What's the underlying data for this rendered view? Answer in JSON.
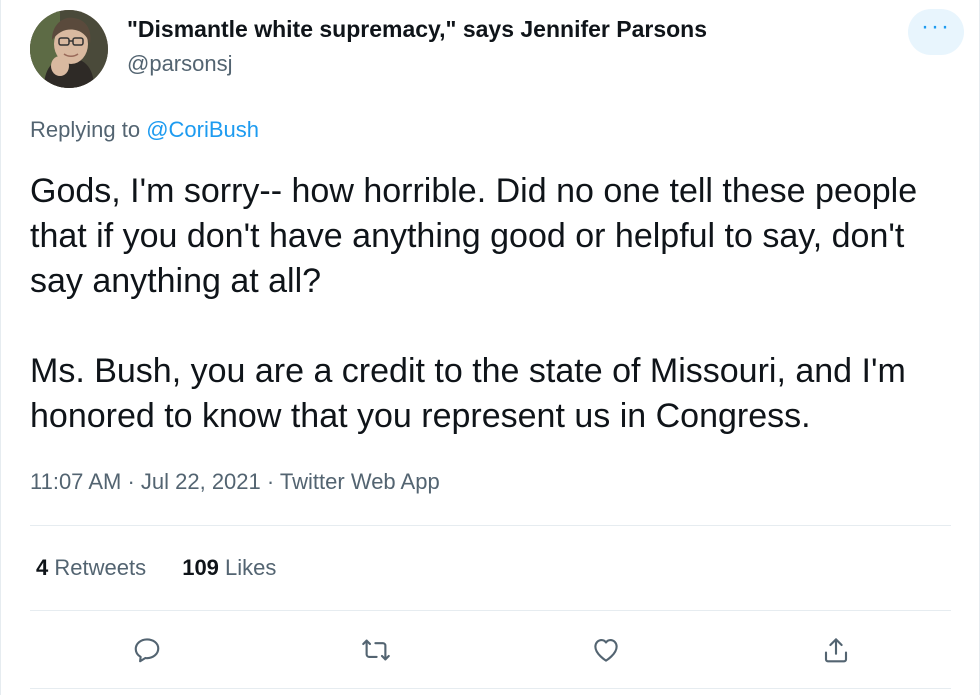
{
  "author": {
    "display_name": "\"Dismantle white supremacy,\" says Jennifer Parsons",
    "handle": "@parsonsj",
    "avatar_icon": "profile-photo"
  },
  "more_button": {
    "icon": "more-horizontal-icon",
    "label": "···"
  },
  "replying": {
    "prefix": "Replying to ",
    "mention": "@CoriBush"
  },
  "body": {
    "paragraph_1": "Gods, I'm sorry-- how horrible. Did no one tell these people that if you don't have anything good or helpful to say, don't say anything at all?",
    "paragraph_2": "Ms. Bush, you are a credit to the state of Missouri, and I'm honored to know that you represent us in Congress."
  },
  "meta": {
    "time": "11:07 AM",
    "separator_1": " · ",
    "date": "Jul 22, 2021",
    "separator_2": " · ",
    "source": "Twitter Web App"
  },
  "stats": {
    "retweets_count": "4",
    "retweets_label": " Retweets",
    "likes_count": "109",
    "likes_label": " Likes"
  },
  "actions": [
    {
      "name": "reply",
      "icon": "reply-icon"
    },
    {
      "name": "retweet",
      "icon": "retweet-icon"
    },
    {
      "name": "like",
      "icon": "heart-icon"
    },
    {
      "name": "share",
      "icon": "share-icon"
    }
  ],
  "colors": {
    "accent": "#1d9bf0",
    "secondary_text": "#536471",
    "primary_text": "#0f1419",
    "divider": "#e6ecf0",
    "more_button_bg": "#e8f5fd"
  }
}
